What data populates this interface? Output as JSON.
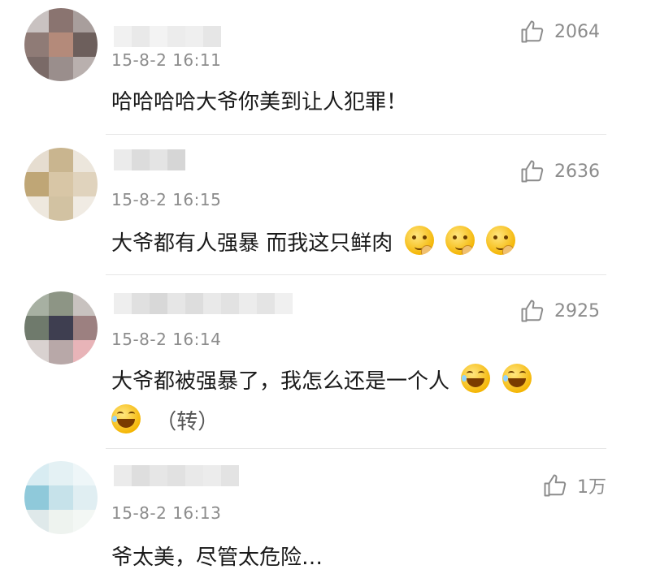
{
  "comments": [
    {
      "timestamp": "15-8-2 16:11",
      "likes": "2064",
      "content": "哈哈哈哈大爷你美到让人犯罪！",
      "content_line2": "",
      "emojis": []
    },
    {
      "timestamp": "15-8-2 16:15",
      "likes": "2636",
      "content": "大爷都有人强暴  而我这只鲜肉",
      "content_line2": "",
      "emojis": [
        "drool-emoji",
        "drool-emoji",
        "drool-emoji"
      ]
    },
    {
      "timestamp": "15-8-2 16:14",
      "likes": "2925",
      "content": "大爷都被强暴了，我怎么还是一个人",
      "content_line2": "（转）",
      "emojis": [
        "laugh-cry-emoji",
        "laugh-cry-emoji",
        "laugh-cry-emoji"
      ]
    },
    {
      "timestamp": "15-8-2 16:13",
      "likes": "1万",
      "content": "爷太美，尽管太危险…",
      "content_line2": "",
      "emojis": []
    }
  ],
  "icons": {
    "like": "thumbs-up-icon"
  },
  "colors": {
    "text": "#1a1a1a",
    "meta": "#8c8c8c",
    "divider": "#e6e6e6"
  }
}
